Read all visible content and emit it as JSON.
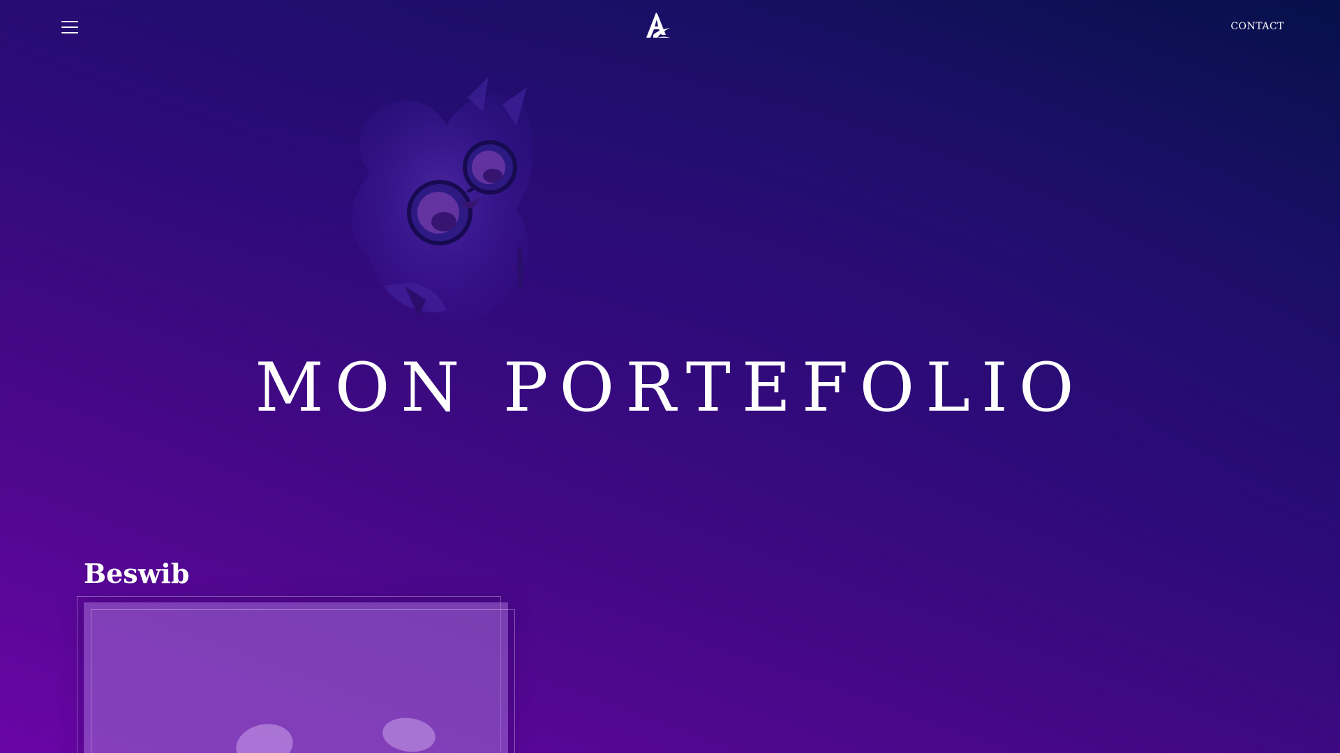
{
  "header": {
    "menu_icon": "hamburger-menu-icon",
    "logo_icon": "brand-logo-icon",
    "contact_label": "CONTACT"
  },
  "hero": {
    "illustration": "owl-with-glasses-illustration",
    "title": "MON PORTEFOLIO"
  },
  "projects": [
    {
      "title": "Beswib",
      "thumbnail": "project-thumbnail"
    }
  ],
  "colors": {
    "background_start": "#06104a",
    "background_end": "#6a05a6",
    "text": "#ffffff",
    "card_overlay": "#a06ed2"
  }
}
